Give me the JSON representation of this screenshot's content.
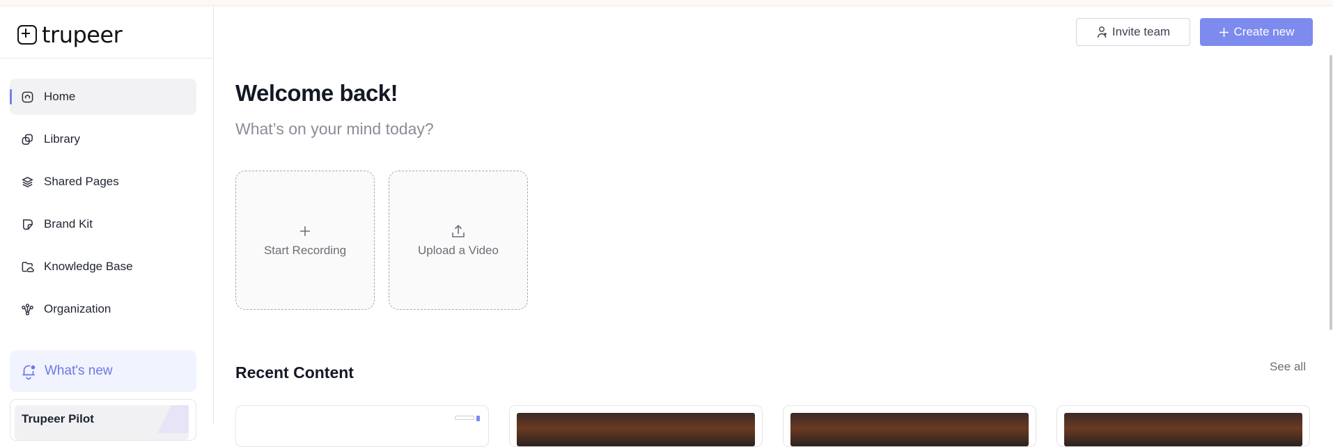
{
  "app": {
    "logo_text": "trupeer"
  },
  "sidebar": {
    "items": [
      {
        "label": "Home",
        "icon": "home-icon",
        "active": true
      },
      {
        "label": "Library",
        "icon": "library-icon",
        "active": false
      },
      {
        "label": "Shared Pages",
        "icon": "layers-icon",
        "active": false
      },
      {
        "label": "Brand Kit",
        "icon": "brand-kit-icon",
        "active": false
      },
      {
        "label": "Knowledge Base",
        "icon": "folder-cloud-icon",
        "active": false
      },
      {
        "label": "Organization",
        "icon": "org-chart-icon",
        "active": false
      }
    ],
    "whats_new_label": "What's new",
    "pilot_label": "Trupeer Pilot"
  },
  "header": {
    "invite_label": "Invite team",
    "create_label": "Create new"
  },
  "main": {
    "title": "Welcome back!",
    "subtitle": "What’s on your mind today?",
    "cards": {
      "record_label": "Start Recording",
      "upload_label": "Upload a Video"
    },
    "recent_title": "Recent Content",
    "see_all_label": "See all"
  },
  "colors": {
    "accent": "#7d8aee",
    "active_indicator": "#7280e9",
    "whats_new_bg": "#f1f3fe"
  }
}
